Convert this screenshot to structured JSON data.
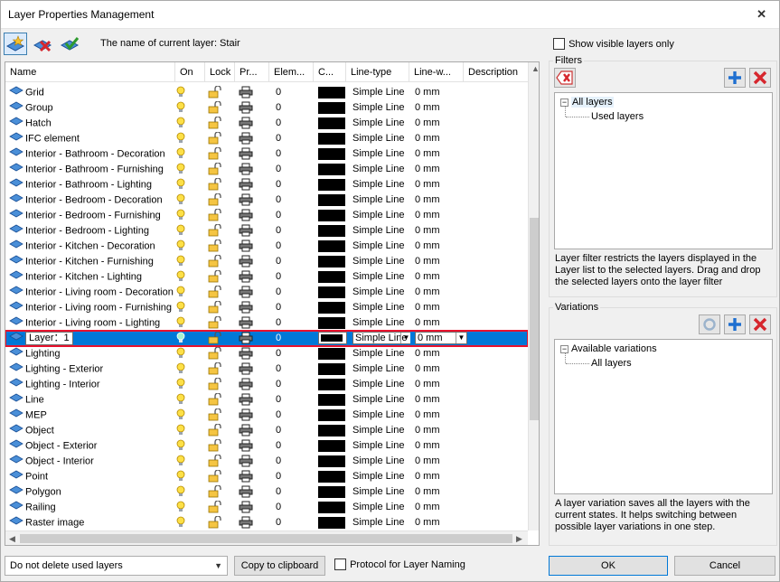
{
  "window": {
    "title": "Layer Properties Management"
  },
  "toolbar": {
    "current_layer_label": "The name of current layer: Stair"
  },
  "table": {
    "columns": [
      "Name",
      "On",
      "Lock",
      "Pr...",
      "Elem...",
      "C...",
      "Line-type",
      "Line-w...",
      "Description"
    ],
    "rows": [
      {
        "name": "Grid",
        "elements": "0",
        "line_type": "Simple Line",
        "line_weight": "0 mm"
      },
      {
        "name": "Group",
        "elements": "0",
        "line_type": "Simple Line",
        "line_weight": "0 mm"
      },
      {
        "name": "Hatch",
        "elements": "0",
        "line_type": "Simple Line",
        "line_weight": "0 mm"
      },
      {
        "name": "IFC element",
        "elements": "0",
        "line_type": "Simple Line",
        "line_weight": "0 mm"
      },
      {
        "name": "Interior - Bathroom - Decoration",
        "elements": "0",
        "line_type": "Simple Line",
        "line_weight": "0 mm"
      },
      {
        "name": "Interior - Bathroom - Furnishing",
        "elements": "0",
        "line_type": "Simple Line",
        "line_weight": "0 mm"
      },
      {
        "name": "Interior - Bathroom - Lighting",
        "elements": "0",
        "line_type": "Simple Line",
        "line_weight": "0 mm"
      },
      {
        "name": "Interior - Bedroom - Decoration",
        "elements": "0",
        "line_type": "Simple Line",
        "line_weight": "0 mm"
      },
      {
        "name": "Interior - Bedroom - Furnishing",
        "elements": "0",
        "line_type": "Simple Line",
        "line_weight": "0 mm"
      },
      {
        "name": "Interior - Bedroom - Lighting",
        "elements": "0",
        "line_type": "Simple Line",
        "line_weight": "0 mm"
      },
      {
        "name": "Interior - Kitchen - Decoration",
        "elements": "0",
        "line_type": "Simple Line",
        "line_weight": "0 mm"
      },
      {
        "name": "Interior - Kitchen - Furnishing",
        "elements": "0",
        "line_type": "Simple Line",
        "line_weight": "0 mm"
      },
      {
        "name": "Interior - Kitchen - Lighting",
        "elements": "0",
        "line_type": "Simple Line",
        "line_weight": "0 mm"
      },
      {
        "name": "Interior - Living room - Decoration",
        "elements": "0",
        "line_type": "Simple Line",
        "line_weight": "0 mm"
      },
      {
        "name": "Interior - Living room - Furnishing",
        "elements": "0",
        "line_type": "Simple Line",
        "line_weight": "0 mm"
      },
      {
        "name": "Interior - Living room - Lighting",
        "elements": "0",
        "line_type": "Simple Line",
        "line_weight": "0 mm"
      },
      {
        "name": "Layer：1",
        "elements": "0",
        "line_type": "Simple Line",
        "line_weight": "0 mm",
        "selected": true
      },
      {
        "name": "Lighting",
        "elements": "0",
        "line_type": "Simple Line",
        "line_weight": "0 mm"
      },
      {
        "name": "Lighting - Exterior",
        "elements": "0",
        "line_type": "Simple Line",
        "line_weight": "0 mm"
      },
      {
        "name": "Lighting - Interior",
        "elements": "0",
        "line_type": "Simple Line",
        "line_weight": "0 mm"
      },
      {
        "name": "Line",
        "elements": "0",
        "line_type": "Simple Line",
        "line_weight": "0 mm"
      },
      {
        "name": "MEP",
        "elements": "0",
        "line_type": "Simple Line",
        "line_weight": "0 mm"
      },
      {
        "name": "Object",
        "elements": "0",
        "line_type": "Simple Line",
        "line_weight": "0 mm"
      },
      {
        "name": "Object - Exterior",
        "elements": "0",
        "line_type": "Simple Line",
        "line_weight": "0 mm"
      },
      {
        "name": "Object - Interior",
        "elements": "0",
        "line_type": "Simple Line",
        "line_weight": "0 mm"
      },
      {
        "name": "Point",
        "elements": "0",
        "line_type": "Simple Line",
        "line_weight": "0 mm"
      },
      {
        "name": "Polygon",
        "elements": "0",
        "line_type": "Simple Line",
        "line_weight": "0 mm"
      },
      {
        "name": "Railing",
        "elements": "0",
        "line_type": "Simple Line",
        "line_weight": "0 mm"
      },
      {
        "name": "Raster image",
        "elements": "0",
        "line_type": "Simple Line",
        "line_weight": "0 mm"
      }
    ]
  },
  "right_panel": {
    "show_visible_label": "Show visible layers only",
    "filters": {
      "label": "Filters",
      "tree": {
        "root": "All layers",
        "child": "Used layers"
      },
      "description": [
        "Layer filter restricts the layers displayed in the",
        "Layer list to the selected layers. Drag and drop",
        "the selected layers onto the layer filter"
      ]
    },
    "variations": {
      "label": "Variations",
      "tree": {
        "root": "Available variations",
        "child": "All layers"
      },
      "description": [
        "A layer variation saves all the layers with the",
        "current states. It helps switching between",
        "possible layer variations in one step."
      ]
    }
  },
  "bottom": {
    "delete_option": "Do not delete used layers",
    "copy_label": "Copy to clipboard",
    "protocol_label": "Protocol for Layer Naming",
    "ok_label": "OK",
    "cancel_label": "Cancel"
  },
  "colors": {
    "selection": "#0078d7",
    "highlight_border": "#e8122d",
    "add": "#1e6fd0",
    "remove": "#d6262d"
  }
}
